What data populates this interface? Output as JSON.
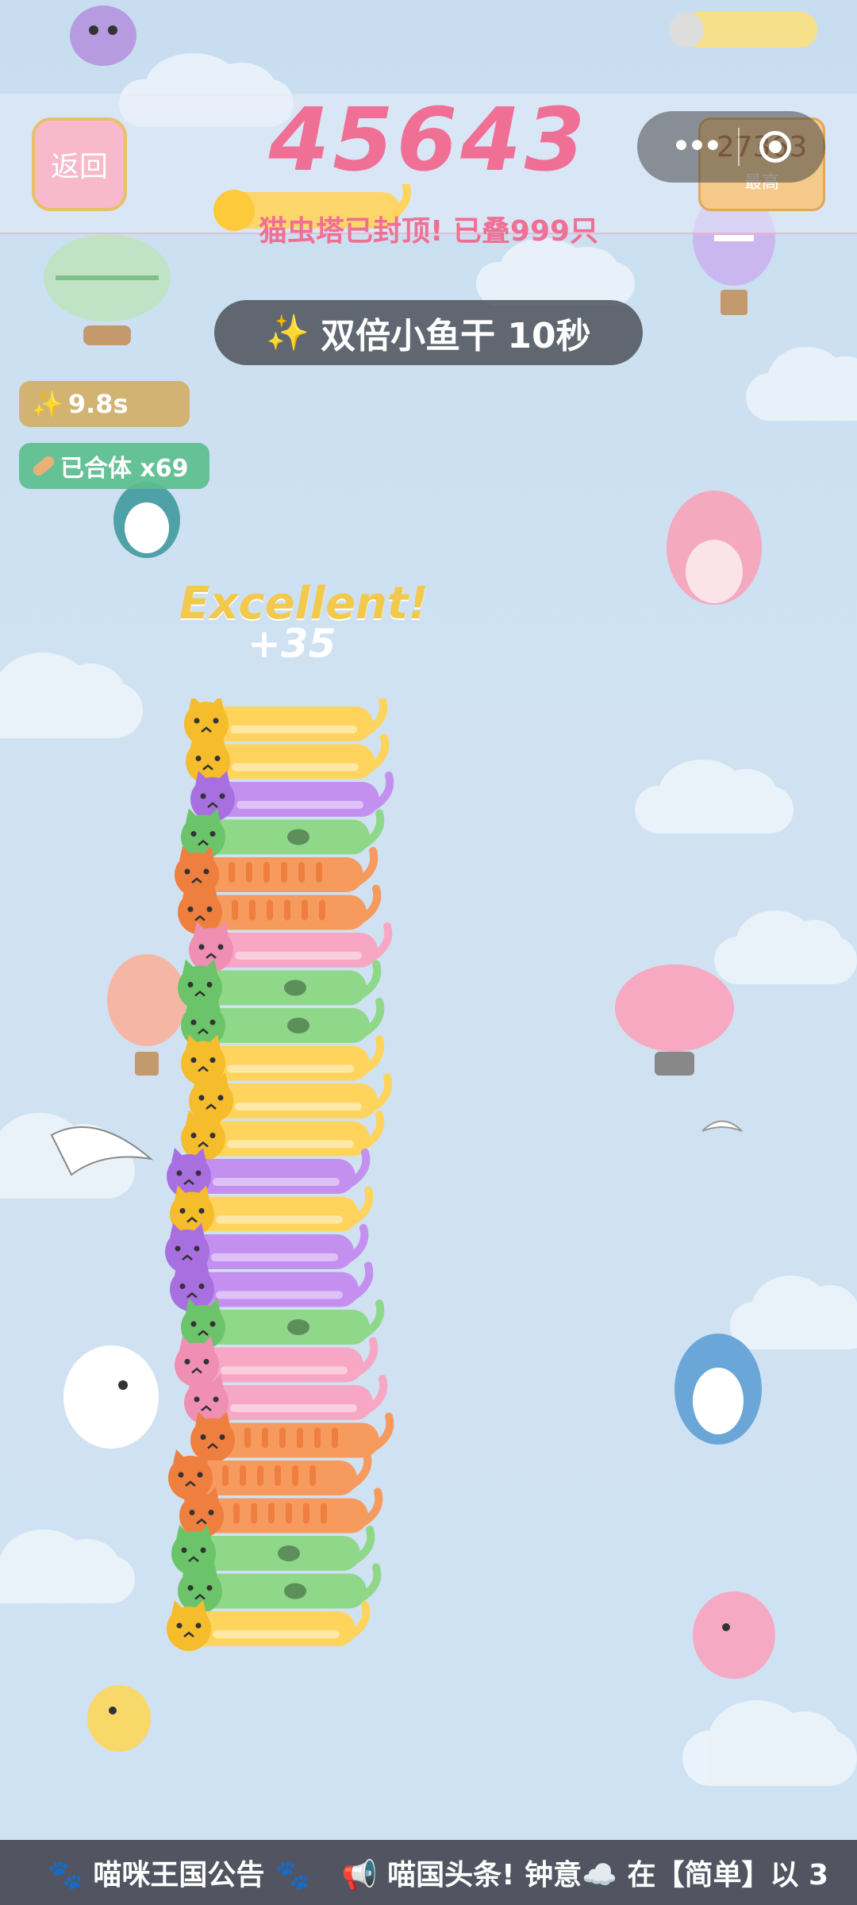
{
  "header": {
    "back_label": "返回",
    "score": "45643",
    "best_score": "27363",
    "best_label": "最高",
    "tower_status": "猫虫塔已封顶! 已叠999只"
  },
  "powerup": {
    "banner": "双倍小鱼干 10秒",
    "timer": "9.8s",
    "merged": "已合体 x69"
  },
  "feedback": {
    "praise": "Excellent!",
    "points": "+35"
  },
  "ticker": {
    "title": "喵咪王国公告",
    "message": "喵国头条! 钟意☁️ 在【简单】以 3"
  },
  "colors": {
    "score": "#f06f95",
    "yellow": "#ffd45c",
    "purple": "#c490f0",
    "green": "#8fd88a",
    "orange": "#f79a5e",
    "pink": "#f7a7c4"
  },
  "tower": [
    "yellow",
    "yellow",
    "purple",
    "green",
    "orange",
    "orange",
    "pink",
    "green",
    "green",
    "yellow",
    "yellow",
    "yellow",
    "purple",
    "yellow",
    "purple",
    "purple",
    "green",
    "pink",
    "pink",
    "orange",
    "orange",
    "orange",
    "green",
    "green",
    "yellow"
  ]
}
